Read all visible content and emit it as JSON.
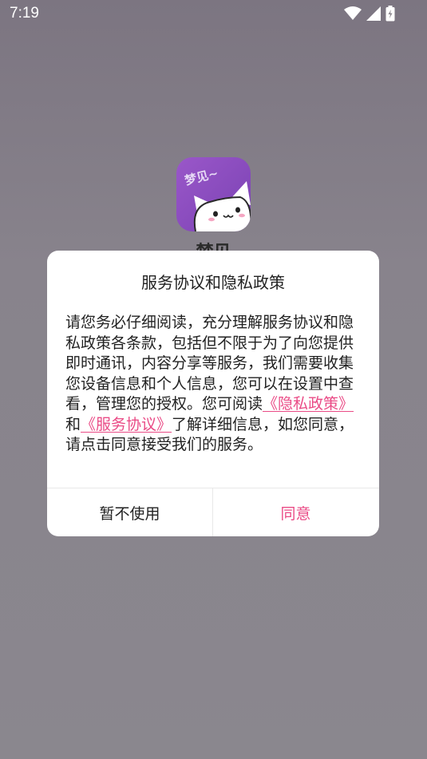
{
  "status_bar": {
    "time": "7:19",
    "icons": [
      "wifi-icon",
      "cellular-signal-icon",
      "battery-charging-icon"
    ]
  },
  "app": {
    "logo_text": "梦见~",
    "name": "梦见"
  },
  "dialog": {
    "title": "服务协议和隐私政策",
    "body_before": "请您务必仔细阅读，充分理解服务协议和隐私政策各条款，包括但不限于为了向您提供即时通讯，内容分享等服务，我们需要收集您设备信息和个人信息，您可以在设置中查看，管理您的授权。您可阅读",
    "privacy_link": "《隐私政策》",
    "connector": "和",
    "service_link": "《服务协议》",
    "body_after": "了解详细信息，如您同意，请点击同意接受我们的服务。",
    "decline_label": "暂不使用",
    "agree_label": "同意"
  },
  "colors": {
    "accent": "#ea4b86",
    "overlay": "#8a868d",
    "logo_purple": "#8a4ec2"
  }
}
